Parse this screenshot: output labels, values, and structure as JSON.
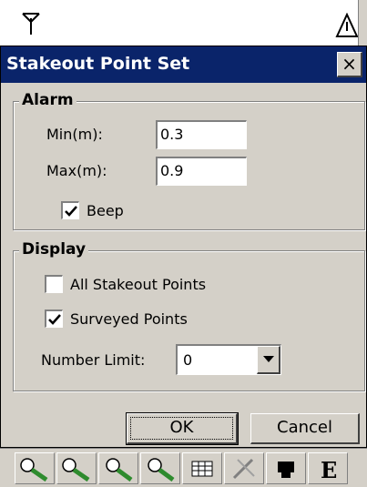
{
  "window": {
    "title": "Stakeout Point Set",
    "close_glyph": "×"
  },
  "status_icons": [
    "antenna-icon",
    "warning-icon"
  ],
  "alarm": {
    "legend": "Alarm",
    "min_label": "Min(m):",
    "min_value": "0.3",
    "max_label": "Max(m):",
    "max_value": "0.9",
    "beep_label": "Beep",
    "beep_checked": true
  },
  "display": {
    "legend": "Display",
    "all_points_label": "All Stakeout Points",
    "all_points_checked": false,
    "surveyed_label": "Surveyed Points",
    "surveyed_checked": true,
    "limit_label": "Number Limit:",
    "limit_value": "0"
  },
  "buttons": {
    "ok": "OK",
    "cancel": "Cancel"
  },
  "toolbar_icons": [
    "zoom-in-icon",
    "zoom-out-icon",
    "zoom-window-icon",
    "zoom-extent-icon",
    "grid-table-icon",
    "tools-icon",
    "satellite-icon",
    "elevation-icon"
  ],
  "colors": {
    "title_bar": "#0a246a",
    "dialog_face": "#d4d0c8",
    "icon_green": "#2e8b2e"
  }
}
